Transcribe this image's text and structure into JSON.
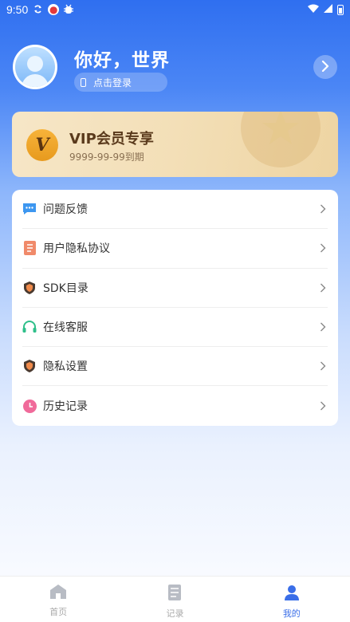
{
  "status_bar": {
    "time": "9:50"
  },
  "profile": {
    "greeting": "你好，世界",
    "login_label": "点击登录"
  },
  "vip": {
    "badge": "V",
    "title": "VIP会员专享",
    "expiry": "9999-99-99到期"
  },
  "menu": [
    {
      "label": "问题反馈",
      "icon": "feedback-icon"
    },
    {
      "label": "用户隐私协议",
      "icon": "document-icon"
    },
    {
      "label": "SDK目录",
      "icon": "shield-icon"
    },
    {
      "label": "在线客服",
      "icon": "headset-icon"
    },
    {
      "label": "隐私设置",
      "icon": "shield-icon"
    },
    {
      "label": "历史记录",
      "icon": "clock-icon"
    }
  ],
  "tabs": [
    {
      "label": "首页",
      "icon": "home-icon"
    },
    {
      "label": "记录",
      "icon": "record-icon"
    },
    {
      "label": "我的",
      "icon": "user-icon"
    }
  ],
  "colors": {
    "accent": "#3a6ee8",
    "vip_gold": "#f2ac32"
  }
}
